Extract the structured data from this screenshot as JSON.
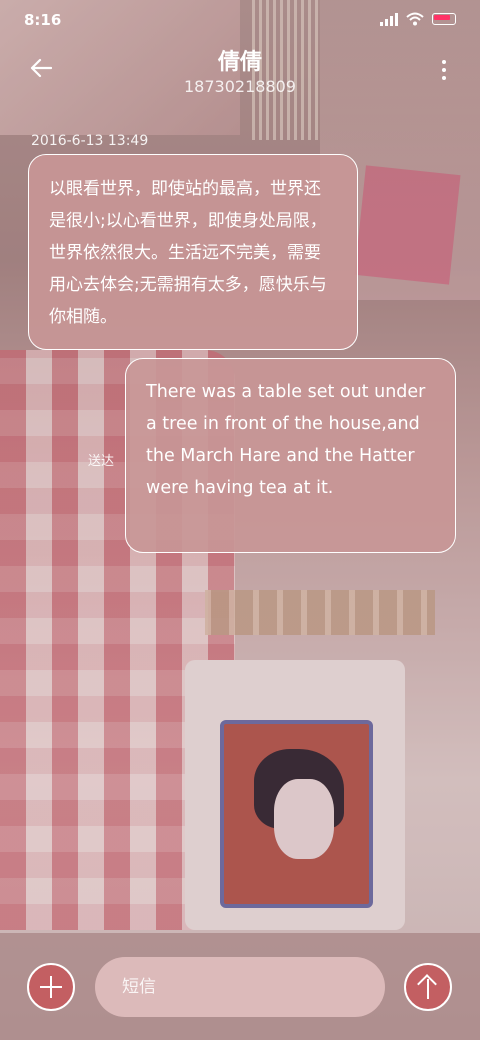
{
  "status_bar": {
    "time": "8:16"
  },
  "header": {
    "contact_name": "倩倩",
    "phone_number": "18730218809",
    "back_icon": "arrow-left-icon",
    "more_icon": "more-vertical-icon"
  },
  "conversation": {
    "timestamp": "2016-6-13 13:49",
    "messages": [
      {
        "direction": "incoming",
        "text": "以眼看世界，即使站的最高，世界还是很小;以心看世界，即使身处局限，世界依然很大。生活远不完美，需要用心去体会;无需拥有太多，愿快乐与你相随。"
      },
      {
        "direction": "outgoing",
        "text": "There was a table set out under a tree in front of the house,and the March Hare and the Hatter were having tea at it.",
        "status": "送达"
      }
    ]
  },
  "input_bar": {
    "placeholder": "短信",
    "add_icon": "plus-icon",
    "send_icon": "arrow-up-icon"
  },
  "colors": {
    "bubble": "#c89696",
    "accent_button": "#c35f62"
  }
}
